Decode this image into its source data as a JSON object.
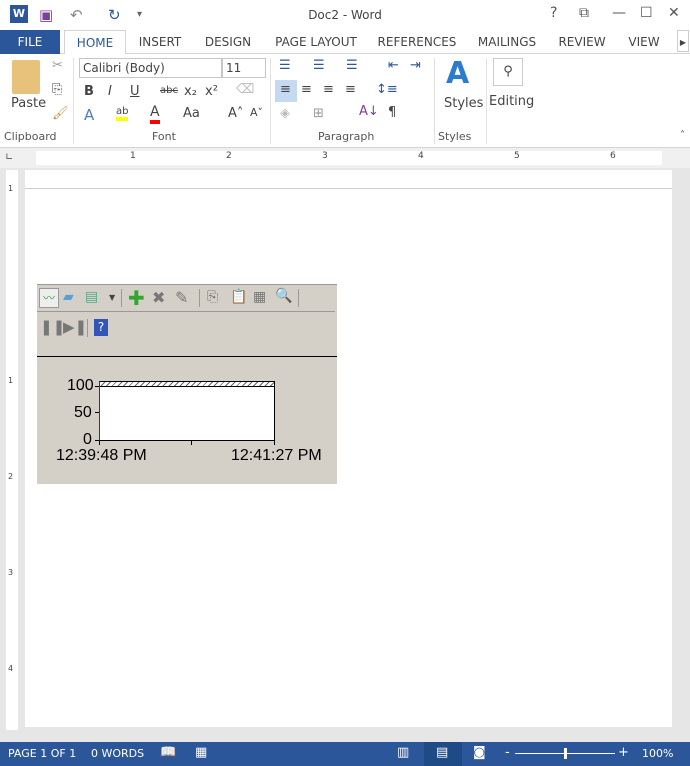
{
  "window": {
    "title": "Doc2 - Word",
    "help": "?",
    "restore": "⧉",
    "minimize": "—",
    "maximize": "☐",
    "close": "✕"
  },
  "quick_access": {
    "word_icon": "W",
    "save": "💾",
    "undo": "↶",
    "redo": "↻",
    "customize": "▾"
  },
  "tabs": [
    "FILE",
    "HOME",
    "INSERT",
    "DESIGN",
    "PAGE LAYOUT",
    "REFERENCES",
    "MAILINGS",
    "REVIEW",
    "VIEW"
  ],
  "ribbon": {
    "clipboard": {
      "paste": "Paste",
      "label": "Clipboard"
    },
    "font": {
      "name": "Calibri (Body)",
      "size": "11",
      "label": "Font",
      "bold": "B",
      "italic": "I",
      "underline": "U",
      "strike": "abc",
      "sub": "x₂",
      "sup": "x²",
      "case": "Aa",
      "grow": "A˄",
      "shrink": "A˅",
      "color": "A",
      "effects": "A",
      "highlight": "ab"
    },
    "paragraph": {
      "label": "Paragraph",
      "pilcrow": "¶"
    },
    "styles": {
      "label": "Styles",
      "button": "Styles"
    },
    "editing": {
      "button": "Editing"
    }
  },
  "ruler": {
    "marks": [
      "1",
      "2",
      "3",
      "4",
      "5",
      "6"
    ],
    "vmarks": [
      "1",
      "1",
      "2",
      "3",
      "4"
    ]
  },
  "control": {
    "y_ticks": [
      "100",
      "50",
      "0"
    ],
    "x_start": "12:39:48 PM",
    "x_end": "12:41:27 PM",
    "help": "?"
  },
  "status": {
    "page": "PAGE 1 OF 1",
    "words": "0 WORDS",
    "zoom": "100%",
    "zoom_minus": "-",
    "zoom_plus": "+",
    "zoom_level": 0.5
  },
  "colors": {
    "accent": "#2b579a",
    "control_bg": "#d4d0c8"
  }
}
